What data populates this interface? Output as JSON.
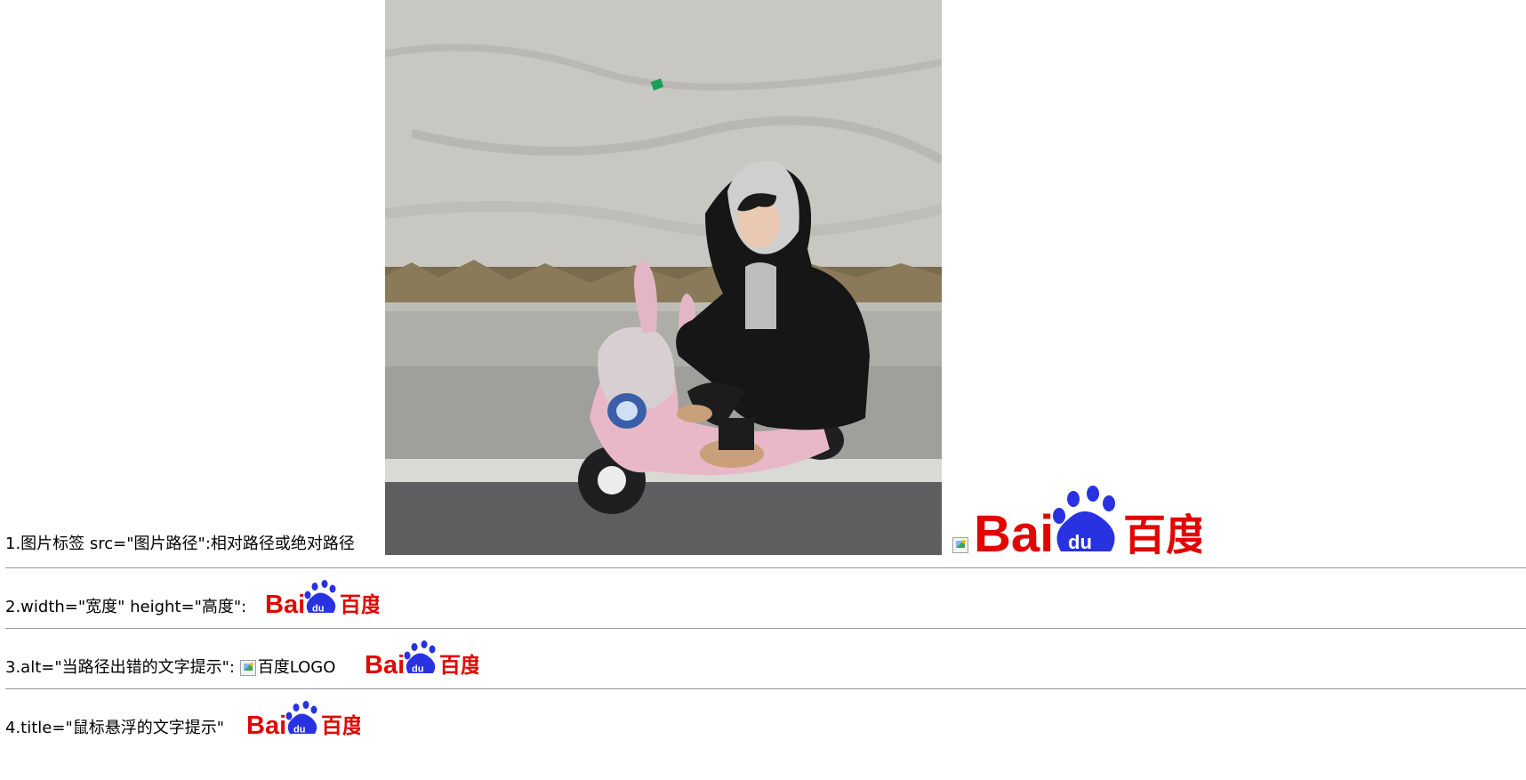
{
  "section1": {
    "caption": "1.图片标签 src=\"图片路径\":相对路径或绝对路径"
  },
  "section2": {
    "caption": "2.width=\"宽度\" height=\"高度\":"
  },
  "section3": {
    "caption": "3.alt=\"当路径出错的文字提示\":",
    "alt_text": "百度LOGO"
  },
  "section4": {
    "caption": "4.title=\"鼠标悬浮的文字提示\""
  },
  "logo": {
    "latin": "Bai",
    "paw": "du",
    "chinese": "百度",
    "red": "#e10601",
    "blue": "#2932e1"
  }
}
